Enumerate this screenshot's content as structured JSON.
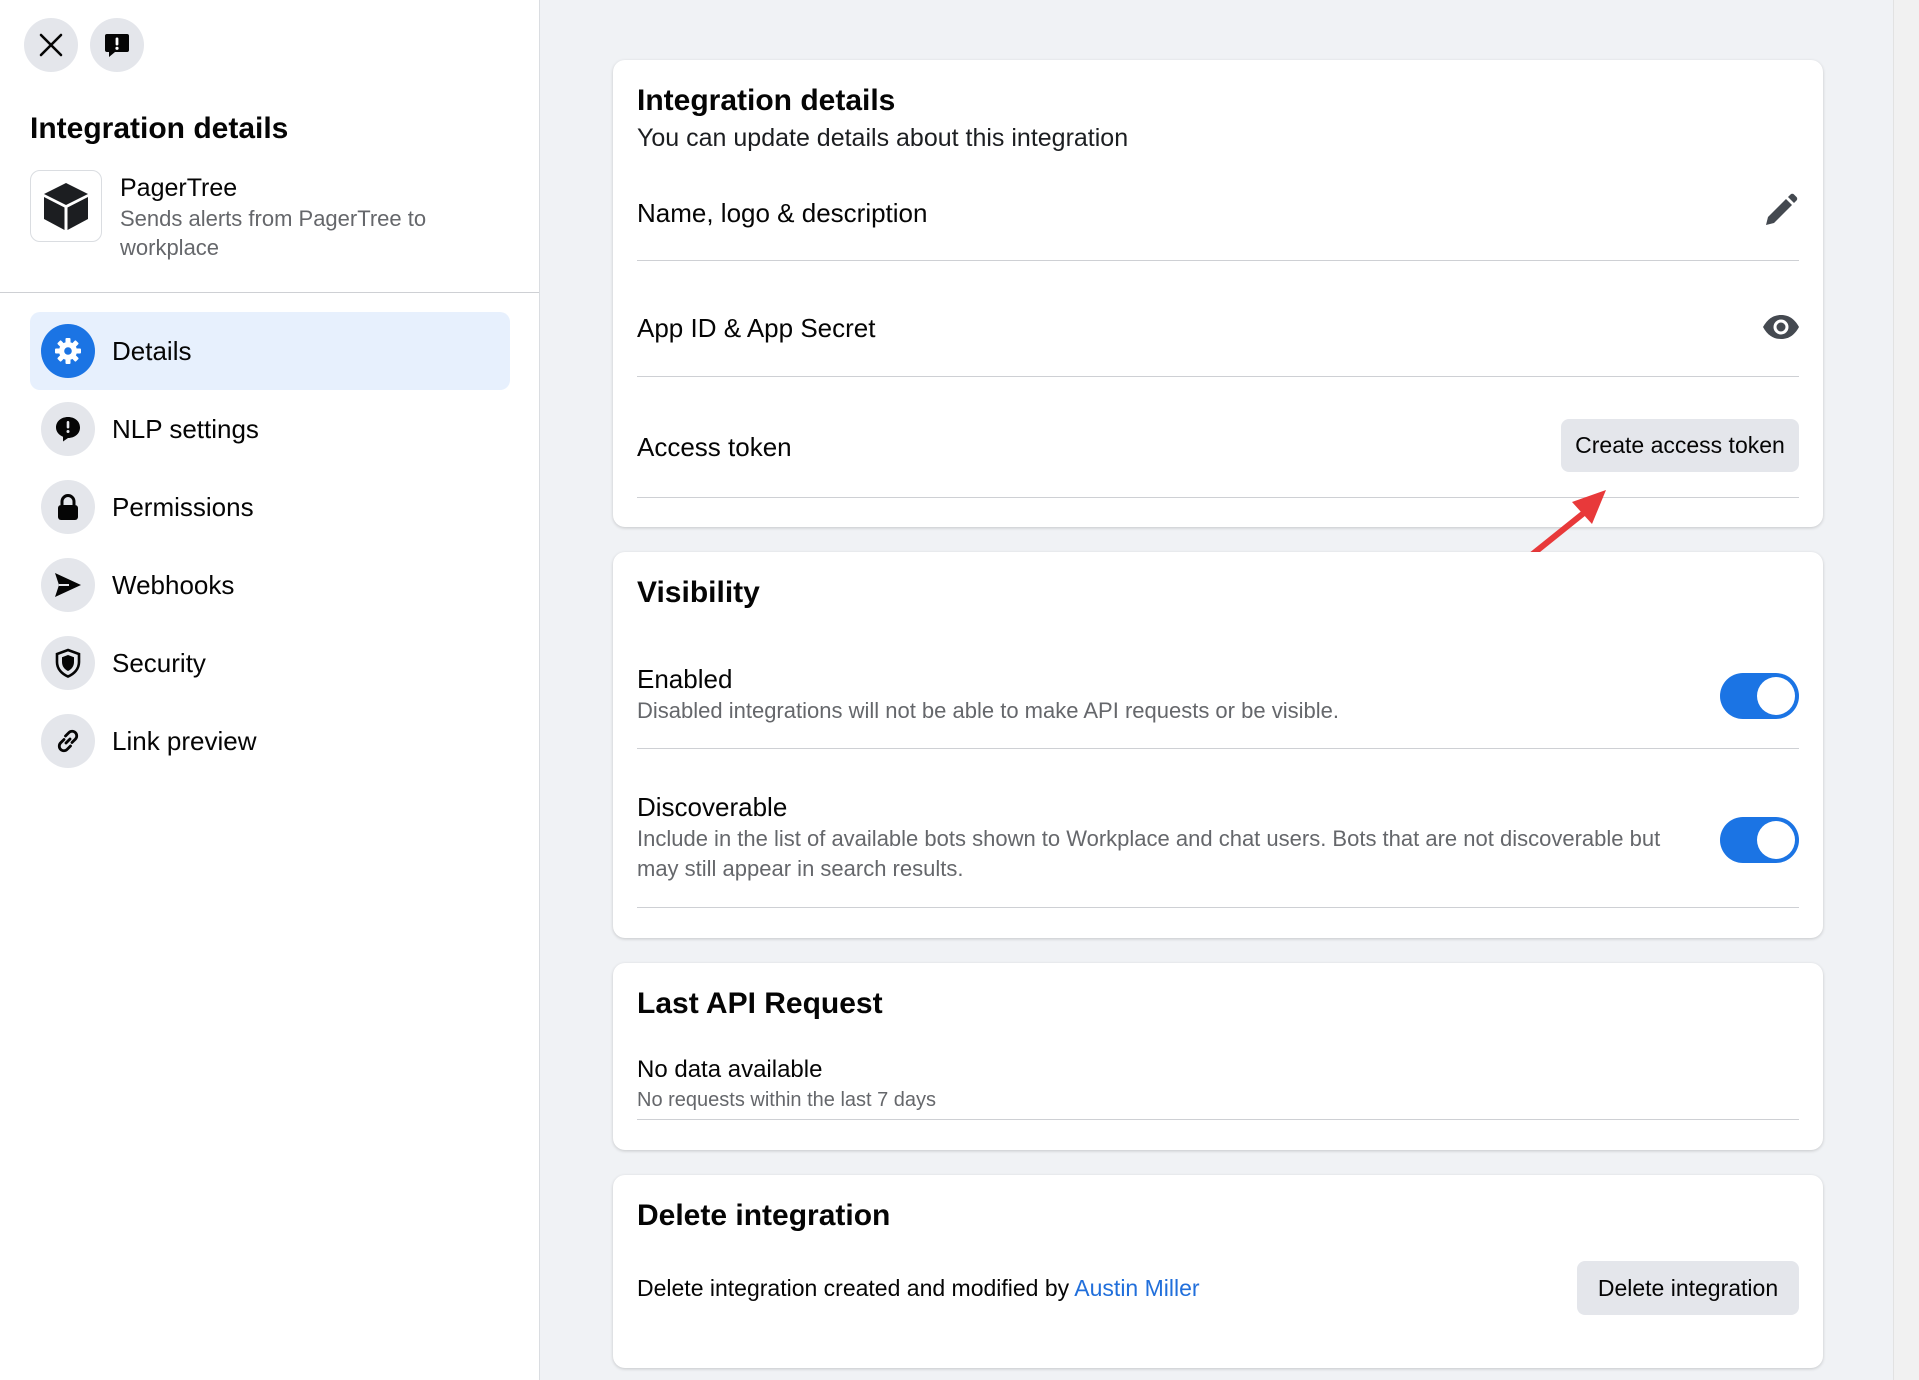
{
  "sidebar": {
    "title": "Integration details",
    "app": {
      "name": "PagerTree",
      "description": "Sends alerts from PagerTree to workplace",
      "logo_icon": "cube-icon"
    },
    "top_buttons": [
      {
        "icon": "close-icon"
      },
      {
        "icon": "report-icon"
      }
    ],
    "nav": [
      {
        "label": "Details",
        "icon": "gear-icon",
        "active": true
      },
      {
        "label": "NLP settings",
        "icon": "chat-bubble-icon",
        "active": false
      },
      {
        "label": "Permissions",
        "icon": "lock-icon",
        "active": false
      },
      {
        "label": "Webhooks",
        "icon": "send-icon",
        "active": false
      },
      {
        "label": "Security",
        "icon": "shield-icon",
        "active": false
      },
      {
        "label": "Link preview",
        "icon": "link-icon",
        "active": false
      }
    ]
  },
  "details_card": {
    "title": "Integration details",
    "subtitle": "You can update details about this integration",
    "rows": {
      "name_logo": "Name, logo & description",
      "app_id": "App ID & App Secret",
      "access_token": "Access token"
    },
    "create_token_button": "Create access token"
  },
  "visibility_card": {
    "title": "Visibility",
    "enabled": {
      "label": "Enabled",
      "description": "Disabled integrations will not be able to make API requests or be visible.",
      "on": true
    },
    "discoverable": {
      "label": "Discoverable",
      "description": "Include in the list of available bots shown to Workplace and chat users. Bots that are not discoverable but may still appear in search results.",
      "on": true
    }
  },
  "last_api_card": {
    "title": "Last API Request",
    "status": "No data available",
    "detail": "No requests within the last 7 days"
  },
  "delete_card": {
    "title": "Delete integration",
    "text": "Delete integration created and modified by",
    "author": "Austin Miller",
    "button": "Delete integration"
  },
  "colors": {
    "accent": "#1b74e4",
    "active_nav_bg": "#e7f0fd",
    "annotation_arrow": "#e8393a",
    "link": "#216fdb"
  }
}
